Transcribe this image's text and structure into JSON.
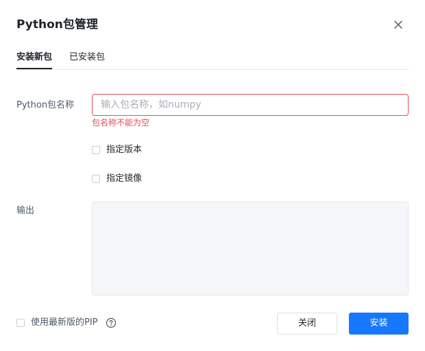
{
  "dialog": {
    "title": "Python包管理"
  },
  "tabs": [
    {
      "label": "安装新包",
      "active": true
    },
    {
      "label": "已安装包",
      "active": false
    }
  ],
  "form": {
    "package_label": "Python包名称",
    "package_input_value": "",
    "package_input_placeholder": "输入包名称，如numpy",
    "package_error": "包名称不能为空",
    "specify_version_label": "指定版本",
    "specify_version_checked": false,
    "specify_mirror_label": "指定镜像",
    "specify_mirror_checked": false,
    "output_label": "输出",
    "output_text": ""
  },
  "footer": {
    "latest_pip_label": "使用最新版的PIP",
    "latest_pip_checked": false,
    "close_label": "关闭",
    "install_label": "安装"
  },
  "icons": {
    "close": "close-icon",
    "help": "help-circle-icon"
  },
  "colors": {
    "primary": "#1677ff",
    "error": "#e34d59",
    "output_bg": "#f5f6f8"
  }
}
